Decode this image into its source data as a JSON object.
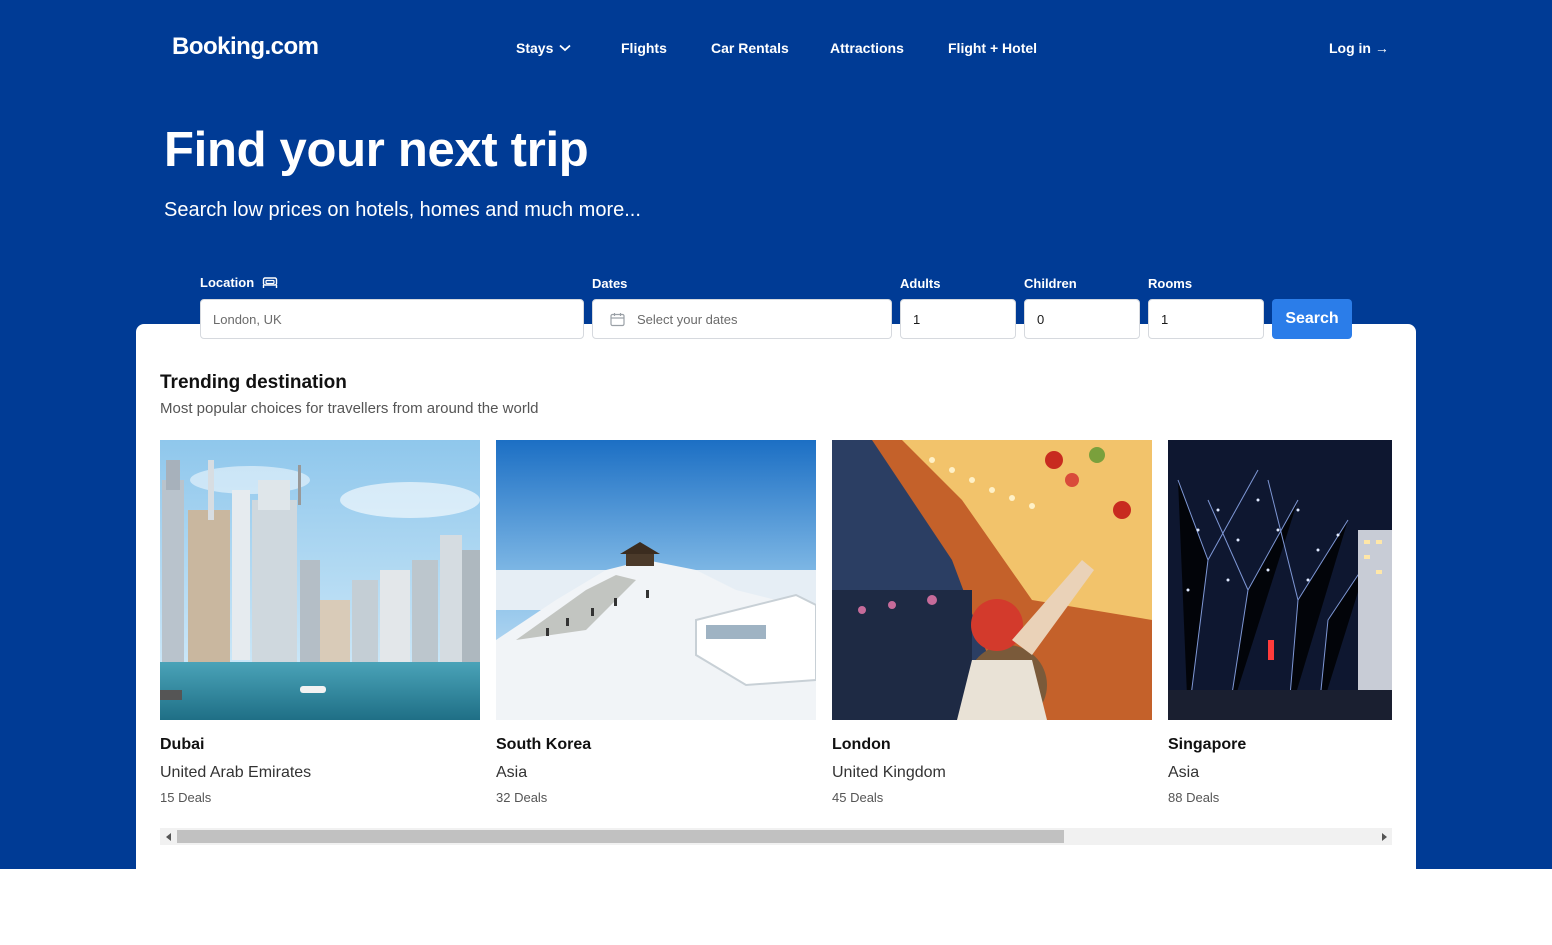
{
  "brand": {
    "logo": "Booking.com",
    "primary_color": "#003b95",
    "accent_color": "#2b7de9"
  },
  "nav": {
    "items": [
      {
        "label": "Stays",
        "has_dropdown": true
      },
      {
        "label": "Flights"
      },
      {
        "label": "Car Rentals"
      },
      {
        "label": "Attractions"
      },
      {
        "label": "Flight + Hotel"
      }
    ],
    "login": "Log in →"
  },
  "hero": {
    "title": "Find your next trip",
    "subtitle": "Search low prices on hotels, homes and much more..."
  },
  "search": {
    "location": {
      "label": "Location",
      "placeholder": "London, UK",
      "icon": "bed-icon"
    },
    "dates": {
      "label": "Dates",
      "placeholder": "Select your dates",
      "icon": "calendar-icon"
    },
    "adults": {
      "label": "Adults",
      "value": "1"
    },
    "children": {
      "label": "Children",
      "value": "0"
    },
    "rooms": {
      "label": "Rooms",
      "value": "1"
    },
    "button": "Search"
  },
  "trending": {
    "title": "Trending destination",
    "subtitle": "Most popular choices for travellers from around the world",
    "items": [
      {
        "name": "Dubai",
        "country": "United Arab Emirates",
        "deals": "15 Deals",
        "image": "dubai-skyline-photo"
      },
      {
        "name": "South Korea",
        "country": "Asia",
        "deals": "32 Deals",
        "image": "snowy-mountain-photo"
      },
      {
        "name": "London",
        "country": "United Kingdom",
        "deals": "45 Deals",
        "image": "christmas-market-photo"
      },
      {
        "name": "Singapore",
        "country": "Asia",
        "deals": "88 Deals",
        "image": "night-lights-photo"
      }
    ]
  }
}
